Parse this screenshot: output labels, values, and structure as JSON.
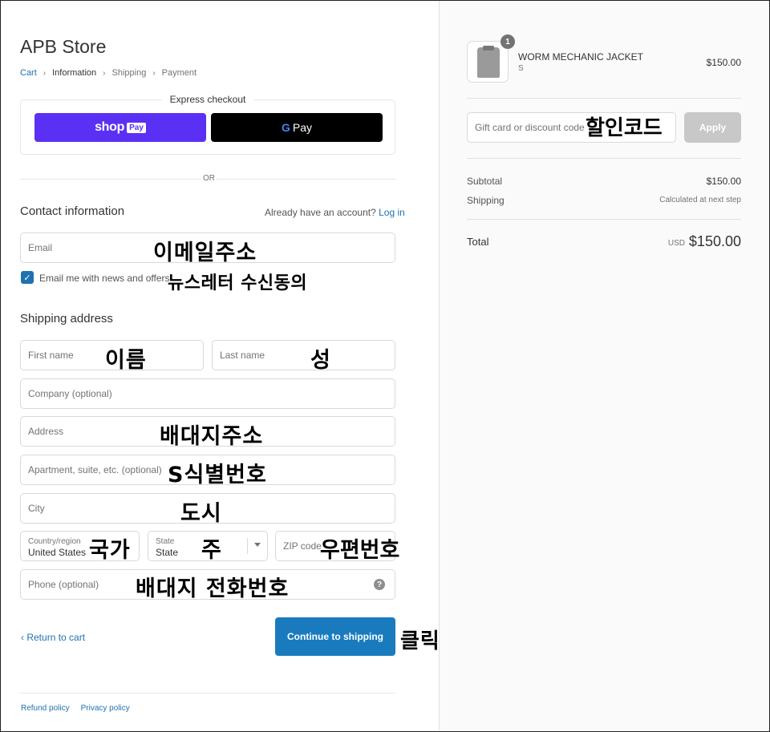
{
  "store": {
    "title": "APB Store"
  },
  "breadcrumb": {
    "cart": "Cart",
    "information": "Information",
    "shipping": "Shipping",
    "payment": "Payment"
  },
  "express": {
    "title": "Express checkout",
    "shop_label": "shop",
    "shop_pay_badge": "Pay",
    "gpay_g": "G",
    "gpay_label": "Pay"
  },
  "divider": {
    "or": "OR"
  },
  "contact": {
    "title": "Contact information",
    "account_text": "Already have an account?",
    "login_link": "Log in",
    "email_placeholder": "Email",
    "email_annotation": "이메일주소",
    "newsletter_label": "Email me with news and offers",
    "newsletter_annotation": "뉴스레터 수신동의",
    "newsletter_checked": true
  },
  "shipping": {
    "title": "Shipping address",
    "first_name": "First name",
    "first_name_annotation": "이름",
    "last_name": "Last name",
    "last_name_annotation": "성",
    "company": "Company (optional)",
    "address": "Address",
    "address_annotation": "배대지주소",
    "apartment": "Apartment, suite, etc. (optional)",
    "apartment_annotation": "S식별번호",
    "city": "City",
    "city_annotation": "도시",
    "country_label": "Country/region",
    "country_value": "United States",
    "country_annotation": "국가",
    "state_label": "State",
    "state_value": "State",
    "state_annotation": "주",
    "zip": "ZIP code",
    "zip_annotation": "우편번호",
    "phone": "Phone (optional)",
    "phone_annotation": "배대지 전화번호",
    "help_icon": "?"
  },
  "actions": {
    "return_label": "Return to cart",
    "continue_label": "Continue to shipping",
    "click_annotation": "클릭"
  },
  "footer": {
    "refund": "Refund policy",
    "privacy": "Privacy policy"
  },
  "summary": {
    "quantity": "1",
    "product_name": "WORM MECHANIC JACKET",
    "variant": "S",
    "product_price": "$150.00",
    "discount_placeholder": "Gift card or discount code",
    "discount_annotation": "할인코드",
    "apply_label": "Apply",
    "subtotal_label": "Subtotal",
    "subtotal_value": "$150.00",
    "shipping_label": "Shipping",
    "shipping_value": "Calculated at next step",
    "total_label": "Total",
    "currency": "USD",
    "total_value": "$150.00"
  },
  "colors": {
    "accent": "#1f72b0",
    "button": "#197bbd",
    "shop_pay": "#5a31f4"
  }
}
